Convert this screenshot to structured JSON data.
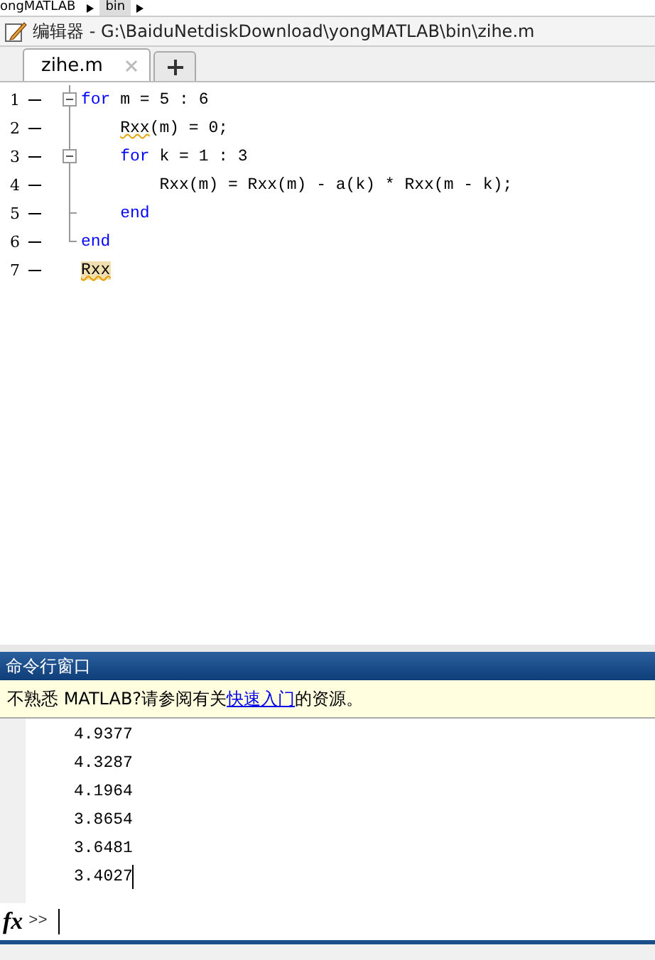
{
  "breadcrumb": [
    "ongMATLAB",
    "bin"
  ],
  "editor": {
    "title": "编辑器 - G:\\BaiduNetdiskDownload\\yongMATLAB\\bin\\zihe.m",
    "tabs": [
      {
        "label": "zihe.m",
        "selected": true
      }
    ],
    "lines": [
      {
        "number": "1",
        "kind": "block",
        "segments": [
          {
            "kind": "keyword",
            "text": "for"
          },
          {
            "kind": "text",
            "text": " m = 5 : 6"
          }
        ],
        "children": [
          {
            "number": "2",
            "kind": "statement",
            "segments": [
              {
                "kind": "warning",
                "text": "Rxx"
              },
              {
                "kind": "text",
                "text": "(m) = 0;"
              }
            ]
          },
          {
            "number": "3",
            "kind": "block",
            "segments": [
              {
                "kind": "keyword",
                "text": "for"
              },
              {
                "kind": "text",
                "text": " k = 1 : 3"
              }
            ],
            "children": [
              {
                "number": "4",
                "kind": "statement",
                "segments": [
                  {
                    "kind": "text",
                    "text": "Rxx(m) = Rxx(m) - a(k) * Rxx(m - k);"
                  }
                ]
              }
            ]
          },
          {
            "number": "5",
            "kind": "end",
            "segments": [
              {
                "kind": "keyword",
                "text": "end"
              }
            ]
          }
        ]
      },
      {
        "number": "6",
        "kind": "end",
        "segments": [
          {
            "kind": "keyword",
            "text": "end"
          }
        ]
      },
      {
        "number": "7",
        "kind": "statement",
        "segments": [
          {
            "kind": "highlight",
            "text": "Rxx"
          }
        ]
      }
    ]
  },
  "command_window": {
    "title": "命令行窗口",
    "notice_before": "不熟悉 MATLAB?请参阅有关",
    "notice_link": "快速入门",
    "notice_after": "的资源。",
    "output": [
      "4.9377",
      "4.3287",
      "4.1964",
      "3.8654",
      "3.6481",
      "3.4027"
    ],
    "function_button": "fx",
    "prompt": ">>"
  }
}
